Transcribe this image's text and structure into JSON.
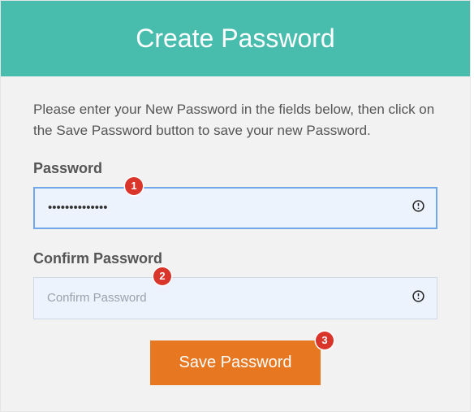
{
  "header": {
    "title": "Create Password"
  },
  "instruction": "Please enter your New Password in the fields below, then click on the Save Password button to save your new Password.",
  "password": {
    "label": "Password",
    "value": "••••••••••••••",
    "placeholder": ""
  },
  "confirm": {
    "label": "Confirm Password",
    "value": "",
    "placeholder": "Confirm Password"
  },
  "actions": {
    "save_label": "Save Password"
  },
  "annotations": {
    "a1": "1",
    "a2": "2",
    "a3": "3"
  }
}
